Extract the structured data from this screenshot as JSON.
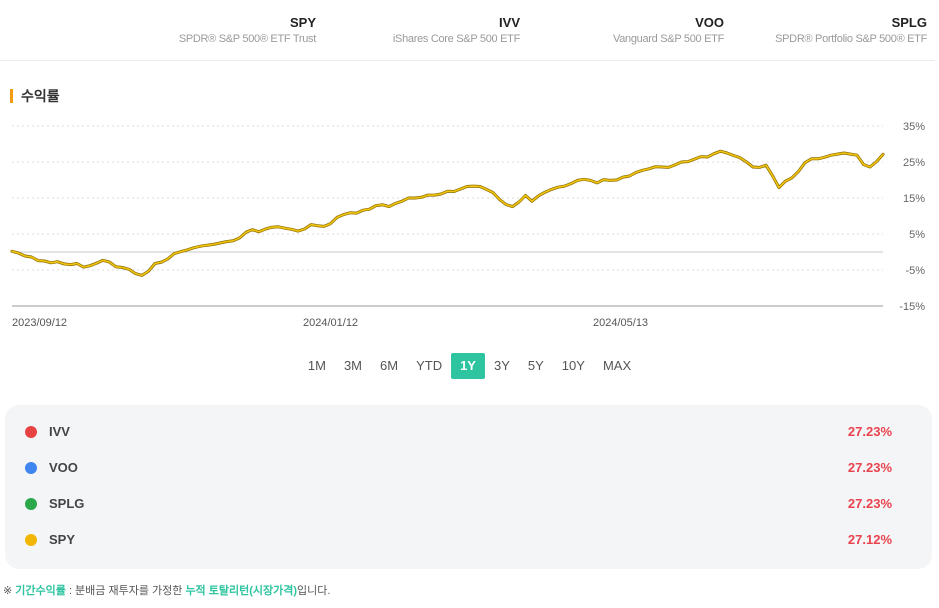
{
  "etfs": [
    {
      "ticker": "SPY",
      "name": "SPDR® S&P 500® ETF Trust"
    },
    {
      "ticker": "IVV",
      "name": "iShares Core S&P 500 ETF"
    },
    {
      "ticker": "VOO",
      "name": "Vanguard S&P 500 ETF"
    },
    {
      "ticker": "SPLG",
      "name": "SPDR® Portfolio S&P 500® ETF"
    }
  ],
  "section_title": "수익률",
  "periods": [
    "1M",
    "3M",
    "6M",
    "YTD",
    "1Y",
    "3Y",
    "5Y",
    "10Y",
    "MAX"
  ],
  "active_period": "1Y",
  "legend": [
    {
      "name": "IVV",
      "color": "#e84343",
      "value": "27.23%"
    },
    {
      "name": "VOO",
      "color": "#3f86f0",
      "value": "27.23%"
    },
    {
      "name": "SPLG",
      "color": "#2aa84a",
      "value": "27.23%"
    },
    {
      "name": "SPY",
      "color": "#f2b705",
      "value": "27.12%"
    }
  ],
  "footnote": {
    "prefix": "※ ",
    "term": "기간수익률",
    "middle": " : 분배금 재투자를 가정한 ",
    "highlight": "누적 토탈리턴(시장가격)",
    "suffix": "입니다."
  },
  "chart_data": {
    "type": "line",
    "x_tick_labels": [
      "2023/09/12",
      "2024/01/12",
      "2024/05/13"
    ],
    "y_tick_labels": [
      "35%",
      "25%",
      "15%",
      "5%",
      "-5%",
      "-15%"
    ],
    "ylim": [
      -15,
      35
    ],
    "series": [
      {
        "name": "SPY",
        "color": "#d4a90a",
        "values": [
          0.2,
          -0.3,
          -1.1,
          -1.4,
          -2.4,
          -2.5,
          -3.0,
          -2.7,
          -3.3,
          -3.5,
          -3.2,
          -4.2,
          -3.8,
          -3.1,
          -2.3,
          -2.8,
          -4.1,
          -4.3,
          -4.8,
          -6.0,
          -6.5,
          -5.3,
          -3.2,
          -2.8,
          -1.9,
          -0.4,
          0.1,
          0.6,
          1.2,
          1.6,
          1.9,
          2.1,
          2.5,
          2.9,
          3.1,
          3.9,
          5.5,
          6.2,
          5.6,
          6.4,
          6.9,
          7.0,
          6.6,
          6.3,
          5.8,
          6.4,
          7.6,
          7.3,
          7.1,
          7.9,
          9.6,
          10.4,
          10.9,
          10.8,
          11.6,
          11.9,
          12.9,
          13.1,
          12.6,
          13.5,
          14.1,
          15.0,
          15.0,
          15.2,
          15.8,
          15.8,
          16.1,
          16.9,
          16.8,
          17.5,
          18.2,
          18.3,
          18.2,
          17.4,
          16.5,
          14.6,
          13.2,
          12.6,
          13.9,
          15.7,
          14.1,
          15.6,
          16.6,
          17.4,
          18.0,
          18.3,
          19.0,
          19.9,
          20.2,
          19.9,
          19.2,
          20.1,
          19.9,
          20.0,
          20.8,
          21.1,
          22.1,
          22.7,
          23.1,
          23.7,
          23.6,
          23.5,
          24.2,
          25.0,
          25.1,
          25.8,
          26.5,
          26.4,
          27.3,
          28.0,
          27.5,
          26.8,
          26.2,
          25.0,
          23.6,
          23.5,
          24.1,
          21.2,
          17.9,
          19.7,
          20.6,
          22.4,
          24.8,
          25.9,
          25.9,
          26.3,
          26.9,
          27.2,
          27.5,
          27.2,
          26.9,
          24.3,
          23.6,
          25.1,
          27.1
        ]
      }
    ],
    "grid": true,
    "legend": "bottom"
  }
}
